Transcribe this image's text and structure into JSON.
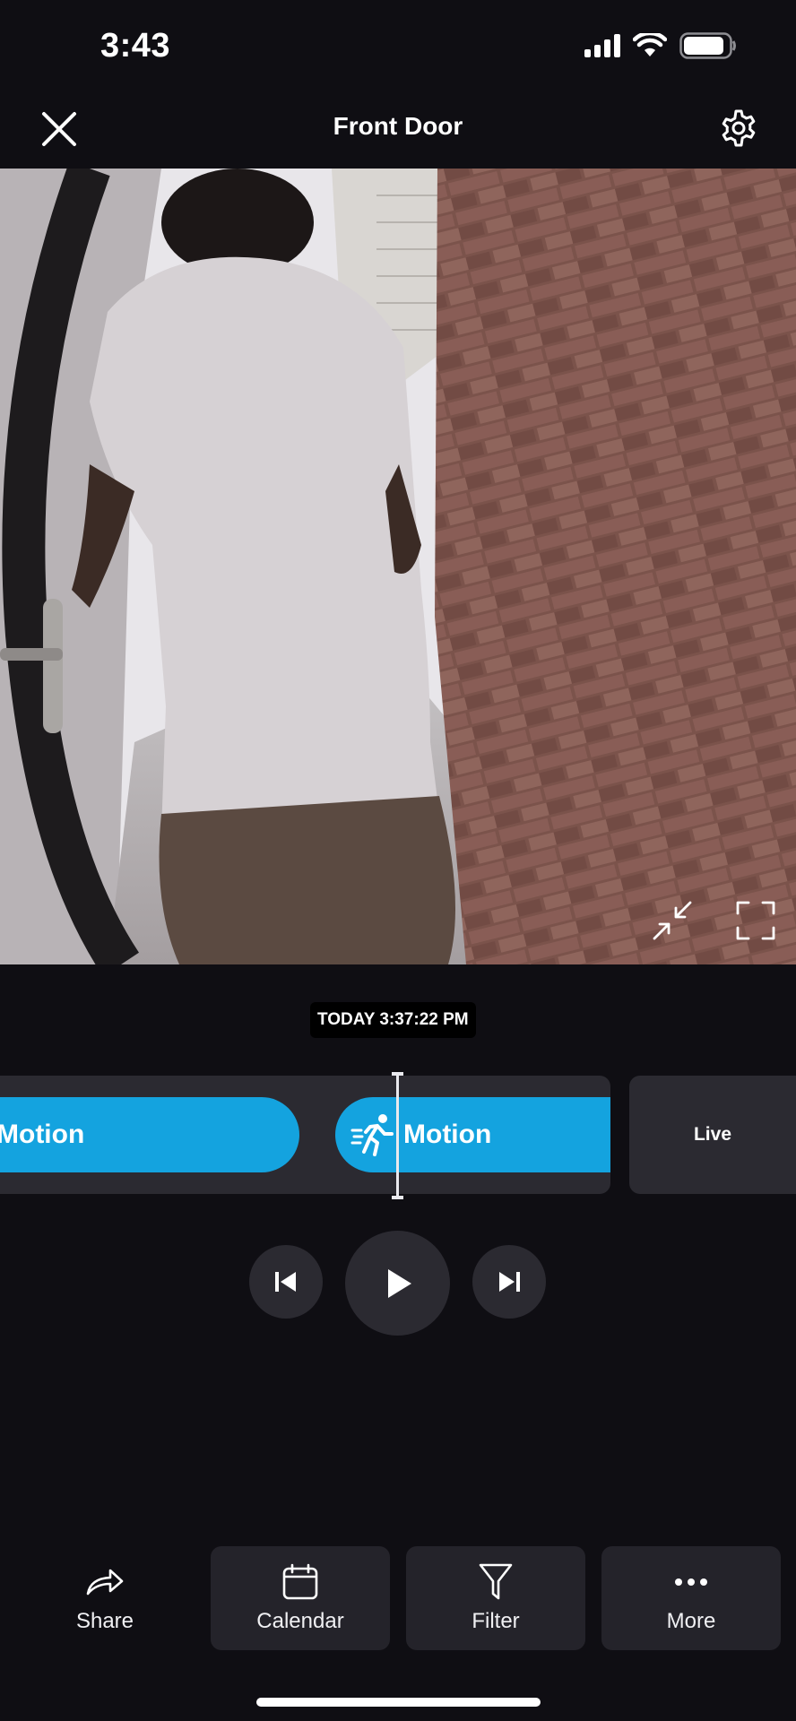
{
  "status_bar": {
    "time": "3:43",
    "icons": [
      "cellular-signal-icon",
      "wifi-icon",
      "battery-icon"
    ]
  },
  "header": {
    "title": "Front Door",
    "close_icon": "close-icon",
    "settings_icon": "gear-icon"
  },
  "video": {
    "buttons": [
      "exit-fullscreen-icon",
      "fullscreen-icon"
    ]
  },
  "playback": {
    "timestamp": "TODAY 3:37:22 PM"
  },
  "timeline": {
    "events": [
      {
        "label": "Motion",
        "icon": "motion-running-person-icon"
      },
      {
        "label": "Motion",
        "icon": "motion-running-person-icon"
      }
    ],
    "live_label": "Live",
    "event_color": "#14a3df"
  },
  "controls": {
    "previous_icon": "skip-previous-icon",
    "play_icon": "play-icon",
    "next_icon": "skip-next-icon"
  },
  "toolbar": {
    "items": [
      {
        "label": "Share",
        "icon": "share-arrow-icon"
      },
      {
        "label": "Calendar",
        "icon": "calendar-icon"
      },
      {
        "label": "Filter",
        "icon": "filter-funnel-icon"
      },
      {
        "label": "More",
        "icon": "more-dots-icon"
      }
    ]
  },
  "colors": {
    "background": "#0f0e13",
    "surface": "#2b2a31",
    "accent": "#14a3df"
  }
}
